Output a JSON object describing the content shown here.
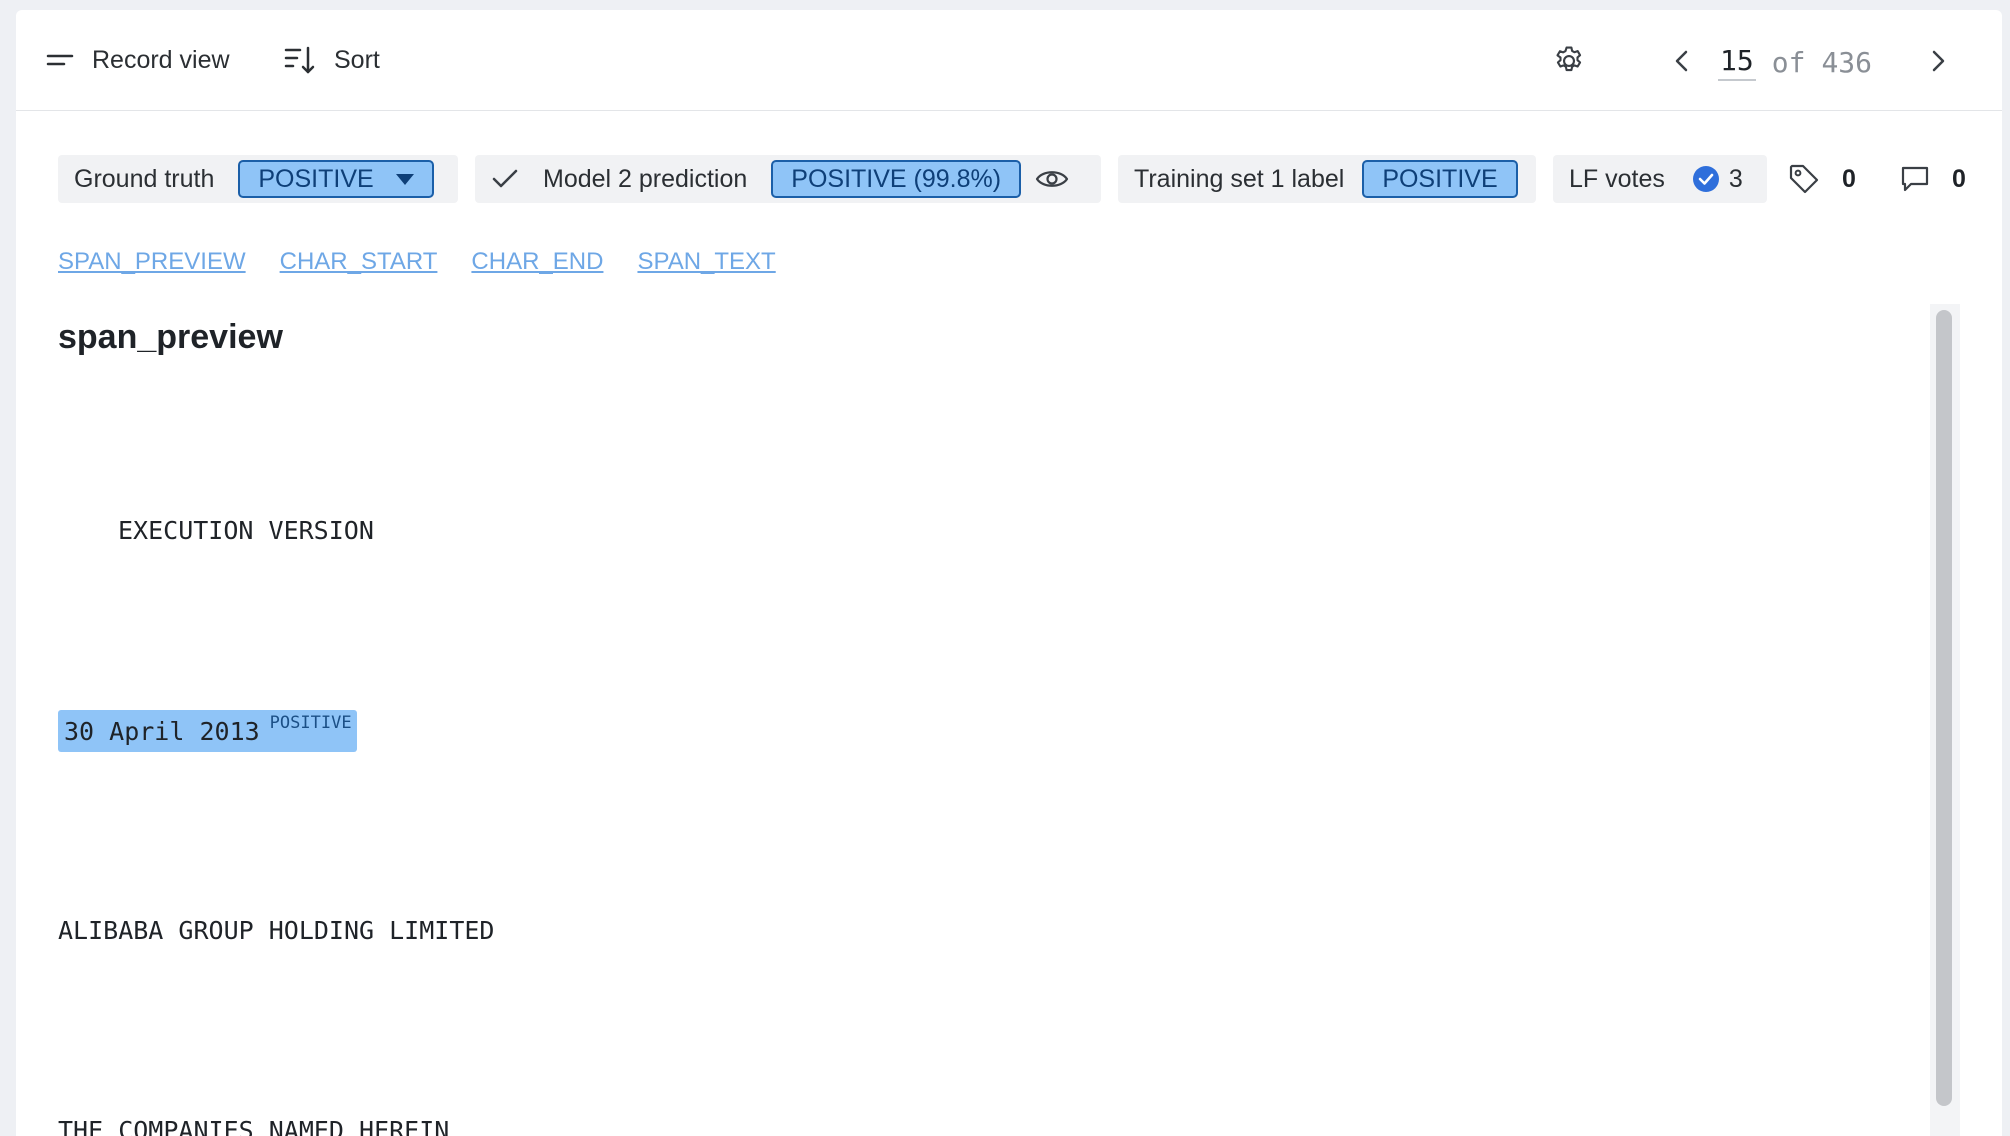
{
  "toolbar": {
    "record_view_label": "Record view",
    "sort_label": "Sort",
    "icons": {
      "record_view": "lines-icon",
      "sort": "sort-icon",
      "settings": "gear-icon",
      "prev": "chevron-left-icon",
      "next": "chevron-right-icon"
    }
  },
  "pager": {
    "current": "15",
    "of_label": "of",
    "total": "436"
  },
  "labels": {
    "ground_truth": {
      "title": "Ground truth",
      "value": "POSITIVE"
    },
    "model_prediction": {
      "title": "Model 2 prediction",
      "value": "POSITIVE (99.8%)"
    },
    "training_set": {
      "title": "Training set 1 label",
      "value": "POSITIVE"
    },
    "lf_votes": {
      "title": "LF votes",
      "count": "3"
    },
    "tags_count": "0",
    "comments_count": "0",
    "pill_color": "#8fc4f7",
    "pill_border_color": "#1b5fa8"
  },
  "fields": [
    {
      "label": "SPAN_PREVIEW"
    },
    {
      "label": "CHAR_START"
    },
    {
      "label": "CHAR_END"
    },
    {
      "label": "SPAN_TEXT"
    }
  ],
  "content": {
    "field_title": "span_preview",
    "lines": [
      "EXECUTION VERSION",
      "ALIBABA GROUP HOLDING LIMITED",
      "THE COMPANIES NAMED HEREIN"
    ],
    "highlighted_span": {
      "text": "30 April 2013",
      "label": "POSITIVE",
      "color": "#8fc4f7"
    }
  }
}
